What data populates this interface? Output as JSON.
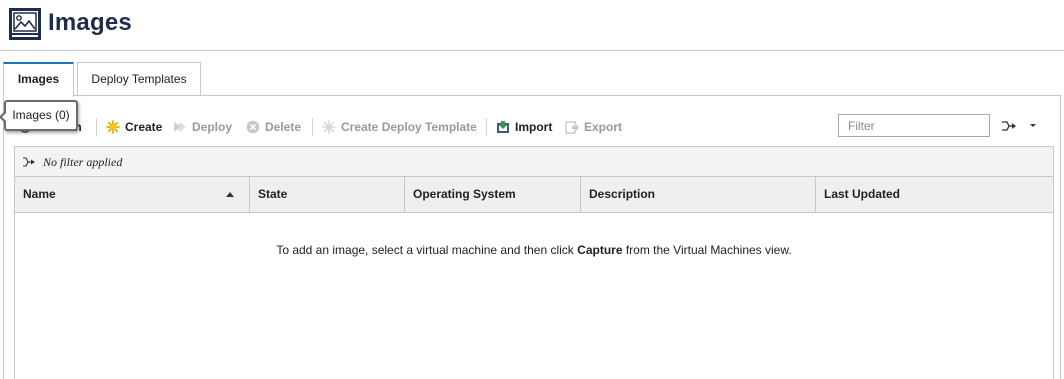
{
  "header": {
    "title": "Images",
    "icon": "images-icon"
  },
  "tabs": [
    {
      "label": "Images",
      "active": true
    },
    {
      "label": "Deploy Templates",
      "active": false
    }
  ],
  "toolbar": {
    "refresh_label": "Refresh",
    "create_label": "Create",
    "deploy_label": "Deploy",
    "delete_label": "Delete",
    "create_template_label": "Create Deploy Template",
    "import_label": "Import",
    "export_label": "Export"
  },
  "filter": {
    "placeholder": "Filter",
    "value": ""
  },
  "tooltip": {
    "text": "Images (0)"
  },
  "grid": {
    "filter_status": "No filter applied",
    "columns": [
      {
        "label": "Name",
        "sorted": "ascending"
      },
      {
        "label": "State"
      },
      {
        "label": "Operating System"
      },
      {
        "label": "Description"
      },
      {
        "label": "Last Updated"
      }
    ],
    "rows": [],
    "empty_message": {
      "before": "To add an image, select a virtual machine and then click ",
      "emphasis": "Capture",
      "after": " from the Virtual Machines view."
    }
  },
  "colors": {
    "title": "#1f2d4d",
    "active_tab_accent": "#1e73be",
    "disabled_text": "#9a9a9a"
  }
}
